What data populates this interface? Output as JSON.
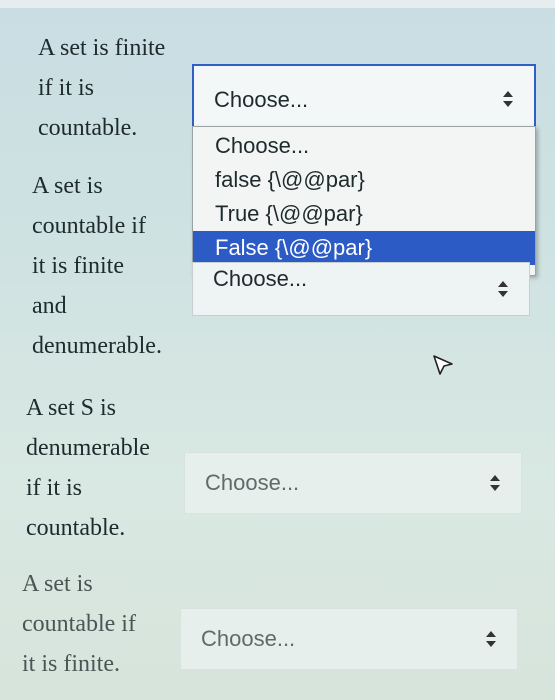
{
  "questions": [
    {
      "text": "A set is finite\nif it is\ncountable.",
      "select_value": "Choose...",
      "open": true
    },
    {
      "text": "A set is\ncountable if\nit is finite\nand\ndenumerable.",
      "select_value": "Choose..."
    },
    {
      "text": "A set S is\ndenumerable\nif it is\ncountable.",
      "select_value": "Choose..."
    },
    {
      "text": "A set is\ncountable if\nit is finite.",
      "select_value": "Choose..."
    }
  ],
  "dropdown_options": [
    {
      "label": "Choose...",
      "selected": false
    },
    {
      "label": "false {\\@@par}",
      "selected": false
    },
    {
      "label": "True {\\@@par}",
      "selected": false
    },
    {
      "label": "False {\\@@par}",
      "selected": true
    }
  ],
  "colors": {
    "highlight": "#2c5bc6",
    "focus_border": "#2f5fc4"
  },
  "icons": {
    "select_arrows": "up-down-arrows-icon",
    "pointer": "mouse-pointer-icon"
  }
}
